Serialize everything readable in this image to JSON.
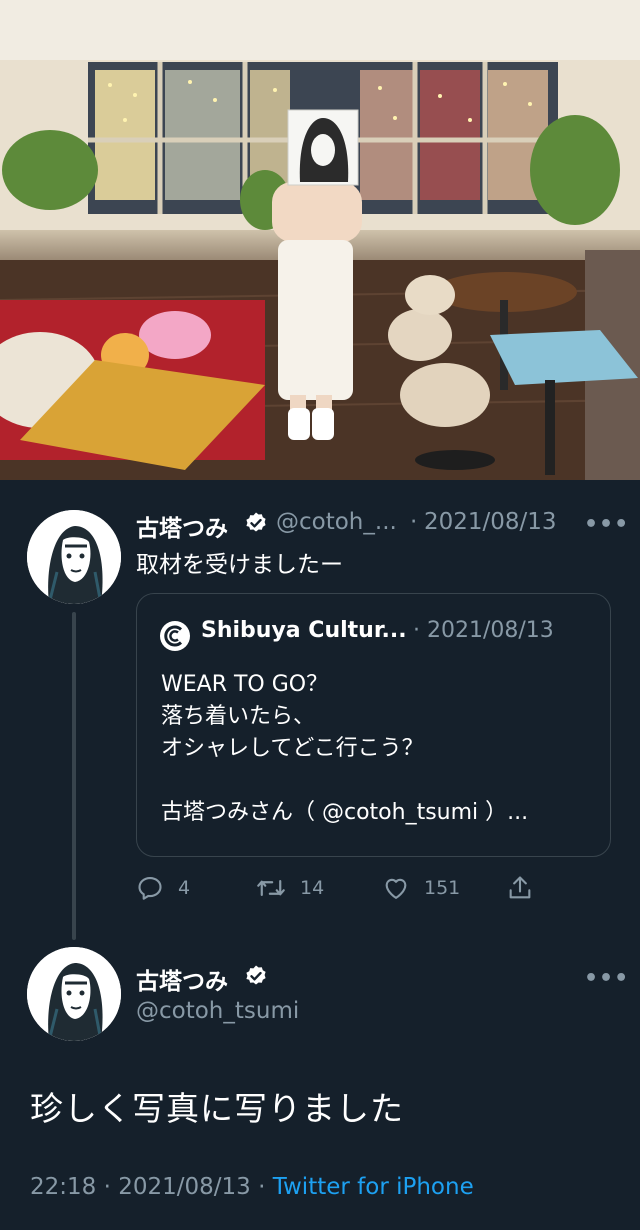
{
  "tweet_quote": {
    "author_name": "古塔つみ",
    "handle": "@cotoh_...",
    "date": "2021/08/13",
    "text": "取材を受けましたー",
    "quoted": {
      "author_name": "Shibuya Cultur...",
      "date": "2021/08/13",
      "lines": [
        "WEAR TO GO？",
        "落ち着いたら、",
        "オシャレしてどこ行こう？",
        "",
        "古塔つみさん（ @cotoh_tsumi ）..."
      ]
    },
    "actions": {
      "replies": "4",
      "retweets": "14",
      "likes": "151"
    }
  },
  "tweet_main": {
    "author_name": "古塔つみ",
    "handle": "@cotoh_tsumi",
    "text": "珍しく写真に写りました",
    "time": "22:18",
    "date": "2021/08/13",
    "source": "Twitter for iPhone"
  },
  "separator": "·",
  "more_label": "•••",
  "icons": {
    "verified": "verified-badge-icon",
    "reply": "reply-icon",
    "retweet": "retweet-icon",
    "like": "heart-icon",
    "share": "share-icon"
  },
  "colors": {
    "background": "#15202b",
    "secondary_text": "#8899a6",
    "link": "#1da1f2",
    "border": "#38444d"
  }
}
